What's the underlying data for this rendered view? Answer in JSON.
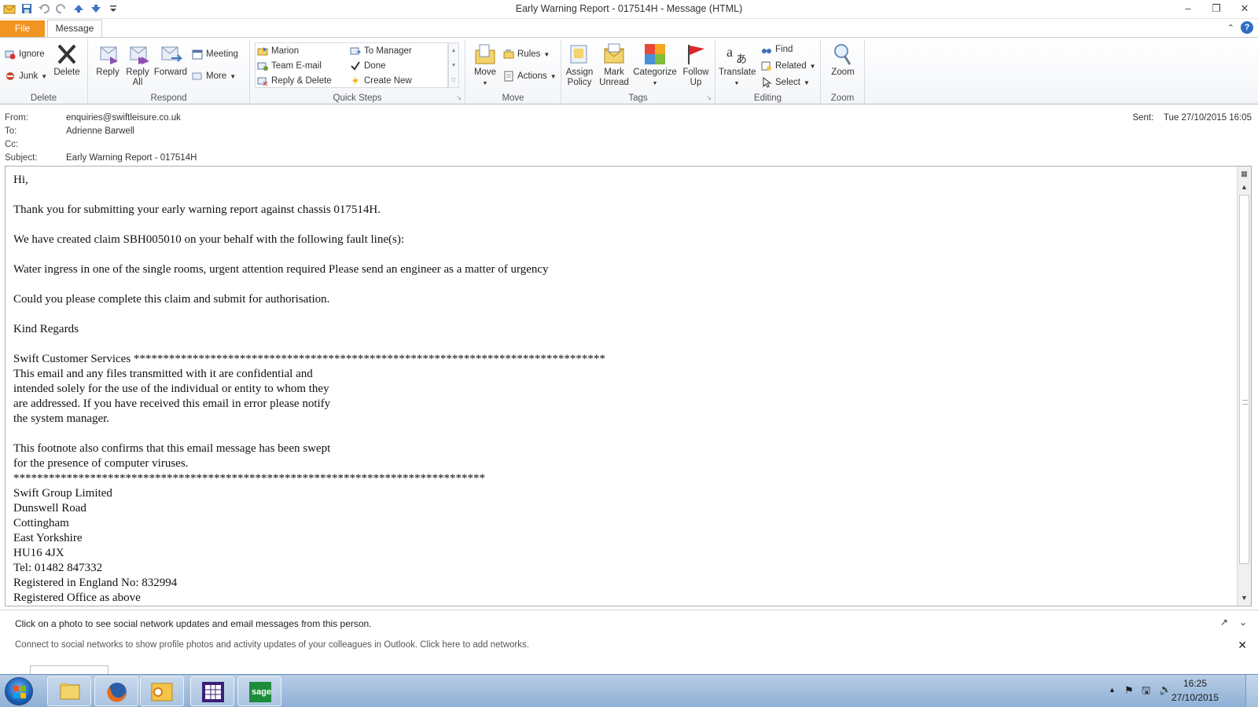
{
  "window": {
    "title": "Early Warning Report - 017514H  -  Message (HTML)"
  },
  "tabs": {
    "file": "File",
    "message": "Message"
  },
  "ribbon": {
    "delete_group": {
      "label": "Delete",
      "ignore": "Ignore",
      "junk": "Junk",
      "delete": "Delete"
    },
    "respond_group": {
      "label": "Respond",
      "reply": "Reply",
      "reply_all_1": "Reply",
      "reply_all_2": "All",
      "forward": "Forward",
      "meeting": "Meeting",
      "more": "More"
    },
    "quicksteps_group": {
      "label": "Quick Steps",
      "items": [
        "Marion",
        "To Manager",
        "Team E-mail",
        "Done",
        "Reply & Delete",
        "Create New"
      ]
    },
    "move_group": {
      "label": "Move",
      "move": "Move",
      "rules": "Rules",
      "actions": "Actions"
    },
    "tags_group": {
      "label": "Tags",
      "assign_1": "Assign",
      "assign_2": "Policy",
      "mark_1": "Mark",
      "mark_2": "Unread",
      "categorize": "Categorize",
      "follow_1": "Follow",
      "follow_2": "Up"
    },
    "editing_group": {
      "label": "Editing",
      "translate": "Translate",
      "find": "Find",
      "related": "Related",
      "select": "Select"
    },
    "zoom_group": {
      "label": "Zoom",
      "zoom": "Zoom"
    }
  },
  "header": {
    "from_label": "From:",
    "from": "enquiries@swiftleisure.co.uk",
    "to_label": "To:",
    "to": "Adrienne Barwell",
    "cc_label": "Cc:",
    "cc": "",
    "subject_label": "Subject:",
    "subject": "Early Warning Report - 017514H",
    "sent_label": "Sent:",
    "sent": "Tue 27/10/2015 16:05"
  },
  "body": {
    "greeting": "Hi,",
    "p1": "Thank you for submitting your early warning report against chassis 017514H.",
    "p2": "We have created claim SBH005010 on your behalf with the following fault line(s):",
    "p3": "Water ingress in one of the single rooms, urgent attention required Please send an engineer as a matter of urgency",
    "p4": "Could you please complete this claim and submit for authorisation.",
    "p5": "Kind Regards",
    "footer_lines_1": [
      "Swift Customer Services ********************************************************************************",
      "This email and any files transmitted with it are confidential and",
      "intended solely for the use of the individual or entity to whom they",
      "are addressed. If you have received this email in error please notify",
      "the system manager."
    ],
    "footer_lines_2": [
      "This footnote also confirms that this email message has been swept",
      "for the presence of computer viruses.",
      "********************************************************************************",
      "Swift Group Limited",
      "Dunswell Road",
      "Cottingham",
      "East Yorkshire",
      "HU16 4JX",
      "Tel: 01482 847332",
      "Registered in England No: 832994",
      "Registered Office as above"
    ]
  },
  "people_pane": {
    "main": "Click on a photo to see social network updates and email messages from this person.",
    "sub": "Connect to social networks to show profile photos and activity updates of your colleagues in Outlook. Click here to add networks."
  },
  "taskbar": {
    "time": "16:25",
    "date": "27/10/2015"
  }
}
